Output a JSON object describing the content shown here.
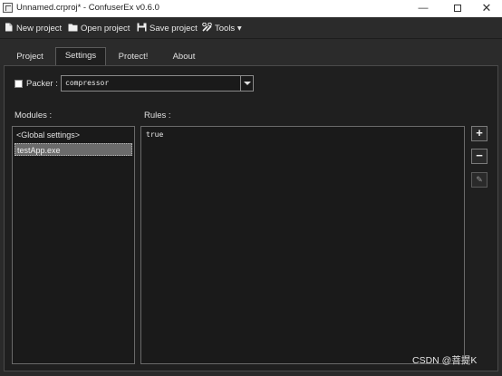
{
  "window": {
    "title": "Unnamed.crproj* - ConfuserEx v0.6.0",
    "minimize_glyph": "—",
    "close_glyph": "✕"
  },
  "toolbar": {
    "new_label": "New project",
    "open_label": "Open project",
    "save_label": "Save project",
    "tools_label": "Tools ▾"
  },
  "tabs": [
    {
      "label": "Project"
    },
    {
      "label": "Settings"
    },
    {
      "label": "Protect!"
    },
    {
      "label": "About"
    }
  ],
  "settings": {
    "packer_enabled": false,
    "packer_label": "Packer :",
    "packer_value": "compressor",
    "modules_label": "Modules :",
    "rules_label": "Rules :",
    "modules": [
      "<Global settings>",
      "testApp.exe"
    ],
    "selected_module": "testApp.exe",
    "rules": [
      "true"
    ],
    "add_glyph": "+",
    "remove_glyph": "−",
    "edit_glyph": "✎"
  },
  "watermark": "CSDN @菩提K",
  "colors": {
    "background": "#2a2a2a",
    "panel": "#1f1f1f",
    "selection": "#6b6b6b",
    "text": "#e0e0e0"
  }
}
